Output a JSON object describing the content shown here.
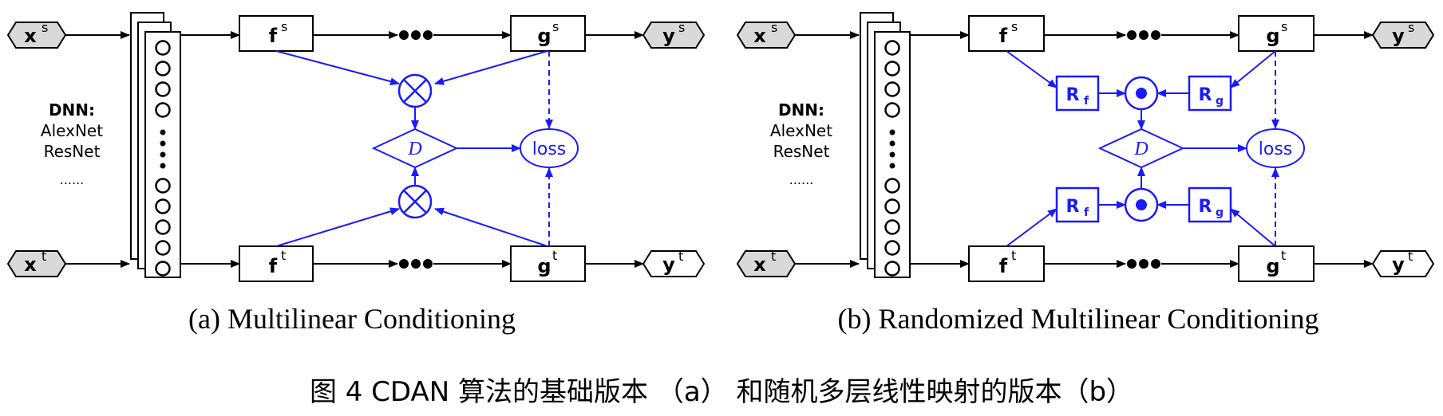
{
  "panels": [
    {
      "id": "a",
      "caption": "(a) Multilinear Conditioning",
      "inputs": {
        "source_main": "x",
        "source_sup": "s",
        "target_main": "x",
        "target_sup": "t"
      },
      "dnn": {
        "title": "DNN:",
        "line1": "AlexNet",
        "line2": "ResNet",
        "line3": "......"
      },
      "features": {
        "fs_main": "f",
        "fs_sup": "s",
        "ft_main": "f",
        "ft_sup": "t"
      },
      "predictions": {
        "gs_main": "g",
        "gs_sup": "s",
        "gt_main": "g",
        "gt_sup": "t"
      },
      "outputs": {
        "ys_main": "y",
        "ys_sup": "s",
        "yt_main": "y",
        "yt_sup": "t"
      },
      "operator_symbol": "⊗",
      "discriminator": "D",
      "loss": "loss"
    },
    {
      "id": "b",
      "caption": "(b) Randomized Multilinear Conditioning",
      "inputs": {
        "source_main": "x",
        "source_sup": "s",
        "target_main": "x",
        "target_sup": "t"
      },
      "dnn": {
        "title": "DNN:",
        "line1": "AlexNet",
        "line2": "ResNet",
        "line3": "......"
      },
      "features": {
        "fs_main": "f",
        "fs_sup": "s",
        "ft_main": "f",
        "ft_sup": "t"
      },
      "predictions": {
        "gs_main": "g",
        "gs_sup": "s",
        "gt_main": "g",
        "gt_sup": "t"
      },
      "outputs": {
        "ys_main": "y",
        "ys_sup": "s",
        "yt_main": "y",
        "yt_sup": "t"
      },
      "random": {
        "rf_main": "R",
        "rf_sub": "f",
        "rg_main": "R",
        "rg_sub": "g"
      },
      "operator_symbol": "⊙",
      "discriminator": "D",
      "loss": "loss"
    }
  ],
  "figure_caption": "图 4 CDAN 算法的基础版本 （a） 和随机多层线性映射的版本（b）",
  "colors": {
    "blue": "#1a1aff",
    "black": "#000000",
    "gray_fill": "#d9d9d9"
  }
}
